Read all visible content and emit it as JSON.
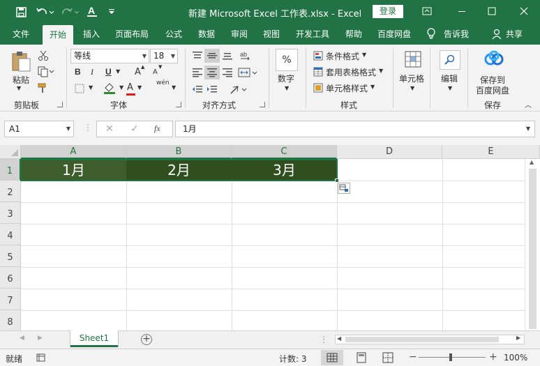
{
  "window": {
    "title": "新建 Microsoft Excel 工作表.xlsx  -  Excel",
    "login_label": "登录"
  },
  "tabs": [
    "文件",
    "开始",
    "插入",
    "页面布局",
    "公式",
    "数据",
    "审阅",
    "视图",
    "开发工具",
    "帮助",
    "百度网盘",
    "告诉我",
    "共享"
  ],
  "ribbon": {
    "clipboard": {
      "paste": "粘贴",
      "label": "剪贴板"
    },
    "font": {
      "name": "等线",
      "size": "18",
      "bold": "B",
      "italic": "I",
      "underline": "U",
      "grow": "A",
      "shrink": "A",
      "color_a": "A",
      "phonetic": "wén",
      "label": "字体"
    },
    "alignment": {
      "label": "对齐方式"
    },
    "number": {
      "symbol": "%",
      "label_btn": "数字"
    },
    "styles": {
      "conditional": "条件格式",
      "table": "套用表格格式",
      "cell": "单元格样式",
      "label": "样式"
    },
    "cells": {
      "label_btn": "单元格"
    },
    "editing": {
      "label_btn": "编辑"
    },
    "save": {
      "line1": "保存到",
      "line2": "百度网盘",
      "label": "保存"
    }
  },
  "formula_bar": {
    "name_box": "A1",
    "fx": "fx",
    "value": "1月"
  },
  "grid": {
    "columns": [
      "A",
      "B",
      "C",
      "D",
      "E"
    ],
    "rows": [
      "1",
      "2",
      "3",
      "4",
      "5",
      "6",
      "7",
      "8"
    ],
    "cells": {
      "A1": "1月",
      "B1": "2月",
      "C1": "3月"
    },
    "selection_color": "#2f4f1f"
  },
  "sheets": [
    "Sheet1"
  ],
  "status": {
    "mode": "就绪",
    "count": "计数: 3",
    "zoom": "100%"
  },
  "accent_color": "#217346"
}
